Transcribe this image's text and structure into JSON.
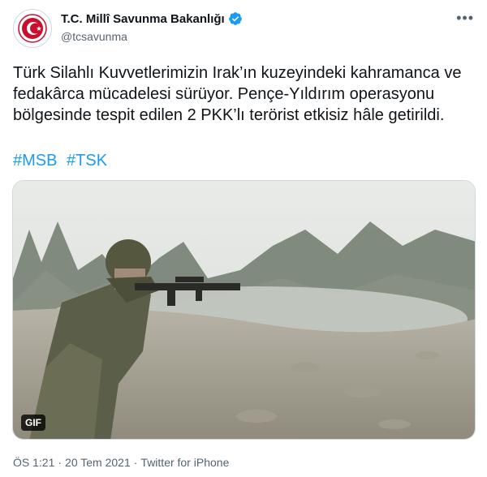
{
  "author": {
    "display_name": "T.C. Millî Savunma Bakanlığı",
    "handle": "@tcsavunma",
    "verified": true,
    "avatar_icon": "crescent-star-emblem-icon",
    "avatar_color": "#c8102e"
  },
  "more_icon": "more-dots-icon",
  "tweet": {
    "text": "Türk Silahlı Kuvvetlerimizin Irak’ın kuzeyindeki kahramanca ve fedakârca mücadelesi sürüyor. Pençe-Yıldırım operasyonu bölgesinde tespit edilen 2 PKK’lı terörist etkisiz hâle getirildi.",
    "hashtags": [
      "#MSB",
      "#TSK"
    ],
    "link_color": "#1d9bf0"
  },
  "media": {
    "badge": "GIF"
  },
  "meta": {
    "time": "ÖS 1:21",
    "separator1": "·",
    "date": "20 Tem 2021",
    "separator2": "·",
    "source": "Twitter for iPhone"
  }
}
